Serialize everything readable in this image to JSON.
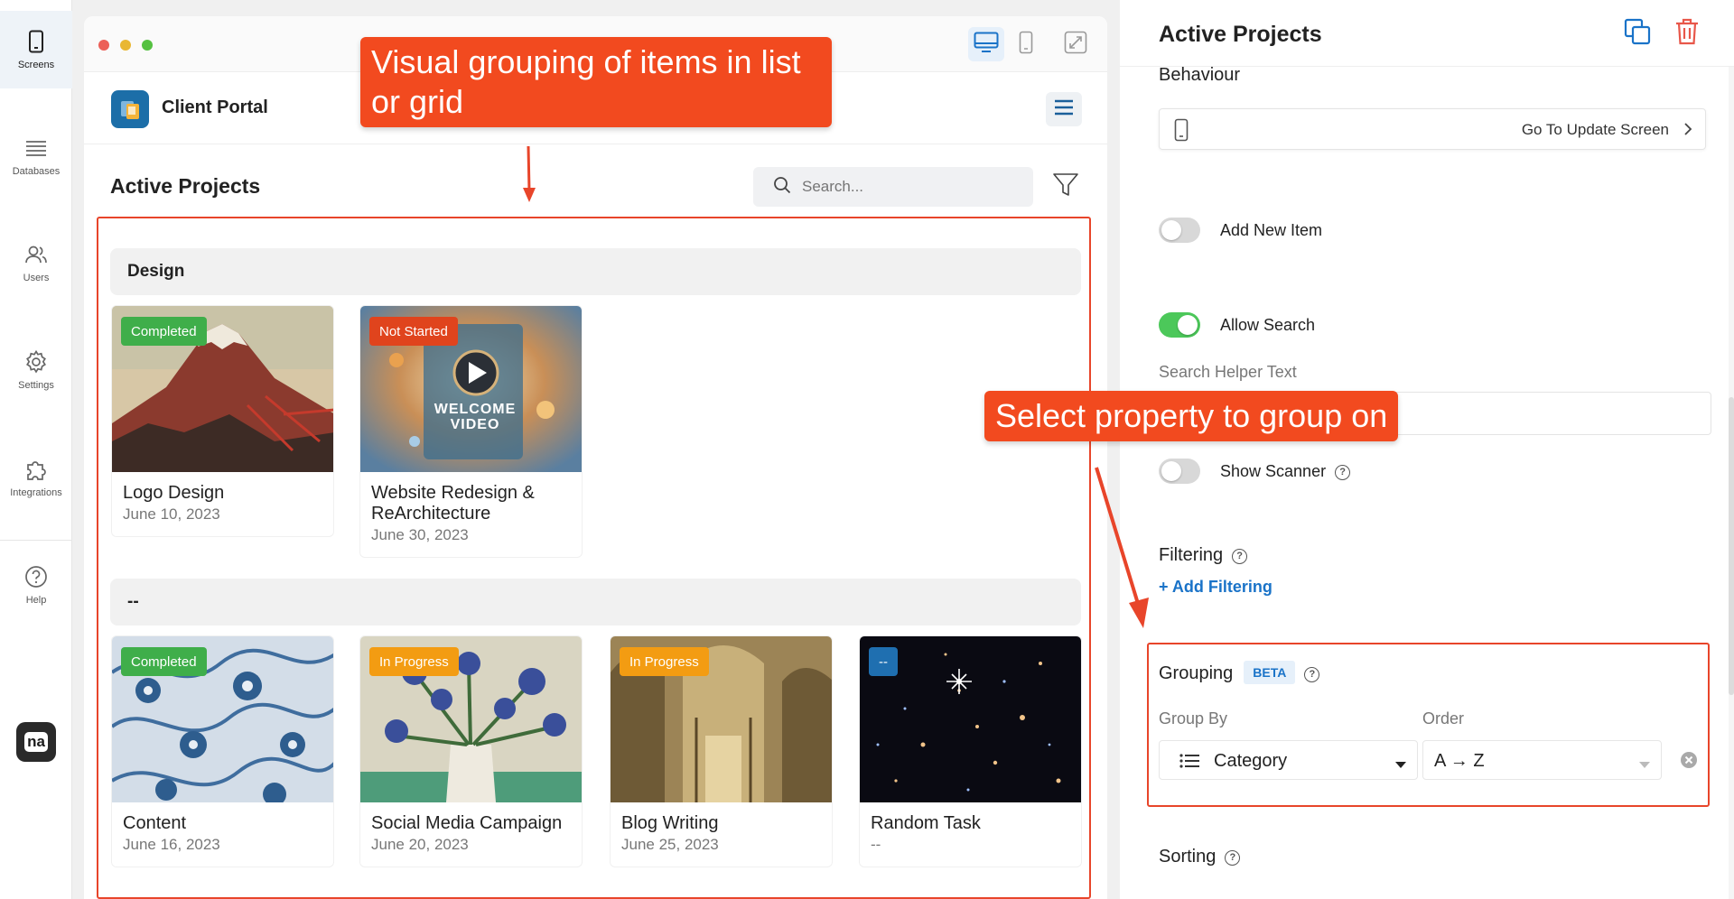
{
  "nav": {
    "items": [
      {
        "label": "Screens",
        "icon": "phone-icon"
      },
      {
        "label": "Databases",
        "icon": "list-icon"
      },
      {
        "label": "Users",
        "icon": "users-icon"
      },
      {
        "label": "Settings",
        "icon": "gear-icon"
      },
      {
        "label": "Integrations",
        "icon": "puzzle-icon"
      },
      {
        "label": "Help",
        "icon": "help-icon"
      }
    ],
    "logo_text": "na"
  },
  "preview": {
    "app_name": "Client Portal",
    "page_title": "Active Projects",
    "search_placeholder": "Search...",
    "groups": [
      {
        "title": "Design",
        "cards": [
          {
            "title": "Logo Design",
            "date": "June 10, 2023",
            "status": "Completed",
            "status_color": "#3fae4a"
          },
          {
            "title": "Website Redesign & ReArchitecture",
            "date": "June 30, 2023",
            "status": "Not Started",
            "status_color": "#e0441d"
          }
        ]
      },
      {
        "title": "--",
        "cards": [
          {
            "title": "Content",
            "date": "June 16, 2023",
            "status": "Completed",
            "status_color": "#3fae4a"
          },
          {
            "title": "Social Media Campaign",
            "date": "June 20, 2023",
            "status": "In Progress",
            "status_color": "#f39c12"
          },
          {
            "title": "Blog Writing",
            "date": "June 25, 2023",
            "status": "In Progress",
            "status_color": "#f39c12"
          },
          {
            "title": "Random Task",
            "date": "--",
            "status": "--",
            "status_color": "#1f6fb0"
          }
        ]
      }
    ],
    "welcome_video_text": "WELCOME VIDEO"
  },
  "callouts": {
    "grouping": "Visual grouping of items in list or grid",
    "property": "Select property to group on"
  },
  "panel": {
    "title": "Active Projects",
    "behaviour_label": "Behaviour",
    "behaviour_value": "Go To Update Screen",
    "add_new_item": {
      "label": "Add New Item",
      "on": false
    },
    "allow_search": {
      "label": "Allow Search",
      "on": true
    },
    "search_helper_label": "Search Helper Text",
    "show_scanner": {
      "label": "Show Scanner",
      "on": false
    },
    "filtering_label": "Filtering",
    "add_filtering": "+ Add Filtering",
    "grouping_label": "Grouping",
    "beta": "BETA",
    "group_by_label": "Group By",
    "group_by_value": "Category",
    "order_label": "Order",
    "order_value": "A → Z",
    "sorting_label": "Sorting"
  },
  "colors": {
    "accent": "#1a73c8",
    "callout": "#f24a1f",
    "outline": "#e8452a",
    "toggle_on": "#4cc85a"
  }
}
